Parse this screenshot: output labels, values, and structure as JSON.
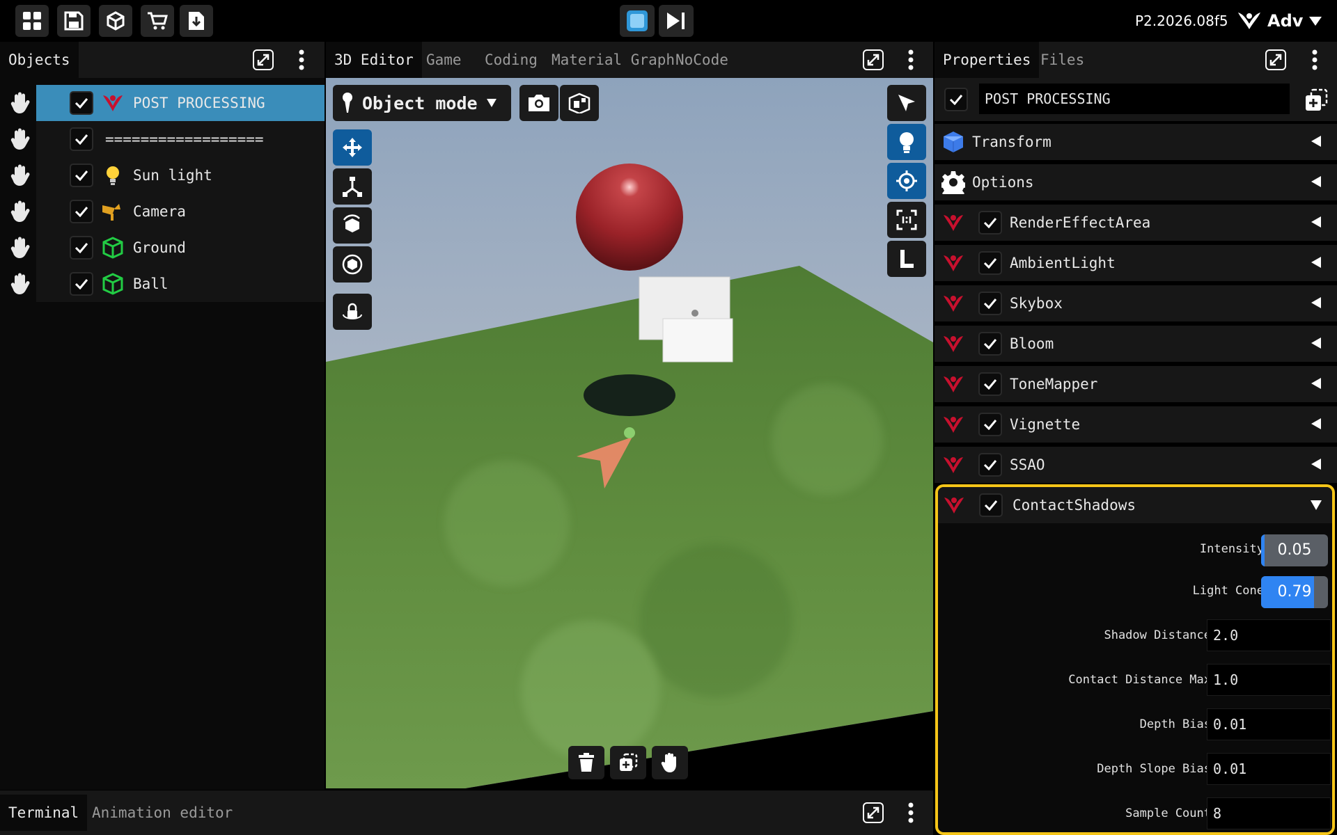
{
  "version": "P2.2026.08f5",
  "user_label": "Adv",
  "objects_panel": {
    "tab": "Objects",
    "items": [
      {
        "label": "POST PROCESSING",
        "icon": "post-processing-icon",
        "selected": true
      },
      {
        "label": "==================",
        "icon": "",
        "selected": false
      },
      {
        "label": "Sun light",
        "icon": "light-bulb-icon",
        "selected": false
      },
      {
        "label": "Camera",
        "icon": "camera-icon",
        "selected": false
      },
      {
        "label": "Ground",
        "icon": "mesh-icon",
        "selected": false
      },
      {
        "label": "Ball",
        "icon": "mesh-icon",
        "selected": false
      }
    ]
  },
  "viewport": {
    "tabs": [
      "3D Editor",
      "Game",
      "Coding",
      "Material Graph",
      "NoCode"
    ],
    "active_tab": "3D Editor",
    "mode": "Object mode"
  },
  "properties": {
    "tabs": [
      "Properties",
      "Files"
    ],
    "active_tab": "Properties",
    "name_value": "POST PROCESSING",
    "sections": [
      {
        "label": "Transform",
        "icon": "transform-cube-icon",
        "checkable": false
      },
      {
        "label": "Options",
        "icon": "gear-icon",
        "checkable": false
      },
      {
        "label": "RenderEffectArea",
        "icon": "post-processing-icon",
        "checkable": true
      },
      {
        "label": "AmbientLight",
        "icon": "post-processing-icon",
        "checkable": true
      },
      {
        "label": "Skybox",
        "icon": "post-processing-icon",
        "checkable": true
      },
      {
        "label": "Bloom",
        "icon": "post-processing-icon",
        "checkable": true
      },
      {
        "label": "ToneMapper",
        "icon": "post-processing-icon",
        "checkable": true
      },
      {
        "label": "Vignette",
        "icon": "post-processing-icon",
        "checkable": true
      },
      {
        "label": "SSAO",
        "icon": "post-processing-icon",
        "checkable": true
      }
    ],
    "expanded_section": {
      "label": "ContactShadows",
      "highlight_color": "#f5c518",
      "sliders": [
        {
          "label": "Intensity",
          "value": "0.05",
          "fraction": 0.05
        },
        {
          "label": "Light Cone",
          "value": "0.79",
          "fraction": 0.79
        }
      ],
      "fields": [
        {
          "label": "Shadow Distance",
          "value": "2.0"
        },
        {
          "label": "Contact Distance Max",
          "value": "1.0"
        },
        {
          "label": "Depth Bias",
          "value": "0.01"
        },
        {
          "label": "Depth Slope Bias",
          "value": "0.01"
        },
        {
          "label": "Sample Count",
          "value": "8"
        }
      ]
    }
  },
  "bottom_panel": {
    "tabs": [
      "Terminal",
      "Animation editor"
    ],
    "active_tab": "Terminal"
  },
  "colors": {
    "accent_blue": "#0f5c9c",
    "selected_row": "#3a8dba",
    "post_processing_red": "#c8102e",
    "mesh_green": "#22cc44",
    "highlight_yellow": "#f5c518"
  }
}
